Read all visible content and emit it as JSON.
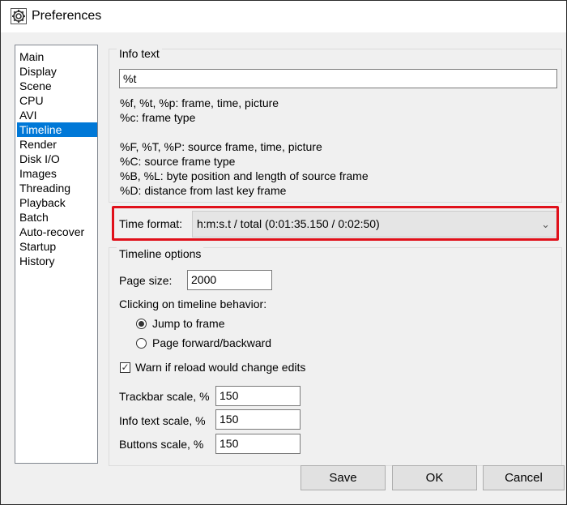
{
  "window": {
    "title": "Preferences",
    "icon": "gear-icon"
  },
  "nav": {
    "selected": "Timeline",
    "items": [
      "Main",
      "Display",
      "Scene",
      "CPU",
      "AVI",
      "Timeline",
      "Render",
      "Disk I/O",
      "Images",
      "Threading",
      "Playback",
      "Batch",
      "Auto-recover",
      "Startup",
      "History"
    ]
  },
  "info_text": {
    "group_label": "Info text",
    "value": "%t",
    "help_lines": [
      "%f, %t, %p: frame, time, picture",
      "%c: frame type",
      "",
      "%F, %T, %P: source frame, time, picture",
      "%C: source frame type",
      "%B, %L: byte position and length of source frame",
      "%D: distance from last key frame"
    ]
  },
  "time_format": {
    "label": "Time format:",
    "selected": "h:m:s.t / total (0:01:35.150 / 0:02:50)",
    "highlight_color": "#e0101a"
  },
  "timeline_options": {
    "group_label": "Timeline options",
    "page_size_label": "Page size:",
    "page_size_value": "2000",
    "click_behavior_label": "Clicking on timeline behavior:",
    "radio_jump": "Jump to frame",
    "radio_page": "Page forward/backward",
    "radio_selected": "Jump to frame",
    "warn_label": "Warn if reload would change edits",
    "warn_checked": true,
    "trackbar_label": "Trackbar scale, %",
    "trackbar_value": "150",
    "infotext_label": "Info text scale, %",
    "infotext_value": "150",
    "buttons_label": "Buttons scale, %",
    "buttons_value": "150"
  },
  "buttons": {
    "save": "Save",
    "ok": "OK",
    "cancel": "Cancel"
  },
  "colors": {
    "selection": "#0078d7",
    "window_bg": "#f0f0f0"
  }
}
